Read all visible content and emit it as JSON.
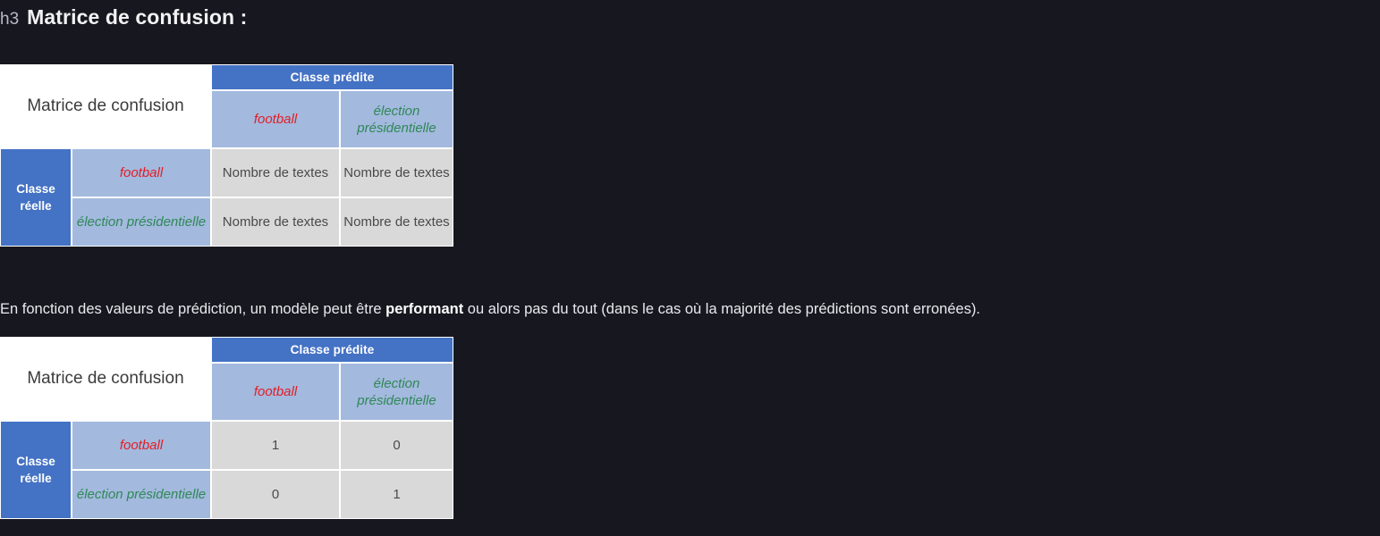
{
  "heading": {
    "tag": "h3",
    "title": "Matrice de confusion :"
  },
  "paragraph": {
    "before_bold": "En fonction des valeurs de prédiction, un modèle peut être ",
    "bold": "performant",
    "after_bold": " ou alors pas du tout (dans le cas où la majorité des prédictions sont erronées)."
  },
  "colors": {
    "page_background": "#17171f",
    "banner_blue": "#4472c4",
    "label_blue": "#a3b9de",
    "data_gray": "#d9d9d9",
    "football_red": "#e31e24",
    "election_green": "#2f8857",
    "corner_white": "#ffffff"
  },
  "tables": [
    {
      "corner_title": "Matrice de confusion",
      "predicted_banner": "Classe prédite",
      "actual_banner": "Classe réelle",
      "predicted_labels": [
        "football",
        "élection présidentielle"
      ],
      "actual_labels": [
        "football",
        "élection présidentielle"
      ],
      "cells": [
        [
          "Nombre de textes",
          "Nombre de textes"
        ],
        [
          "Nombre de textes",
          "Nombre de textes"
        ]
      ]
    },
    {
      "corner_title": "Matrice de confusion",
      "predicted_banner": "Classe prédite",
      "actual_banner": "Classe réelle",
      "predicted_labels": [
        "football",
        "élection présidentielle"
      ],
      "actual_labels": [
        "football",
        "élection présidentielle"
      ],
      "cells": [
        [
          "1",
          "0"
        ],
        [
          "0",
          "1"
        ]
      ]
    }
  ]
}
